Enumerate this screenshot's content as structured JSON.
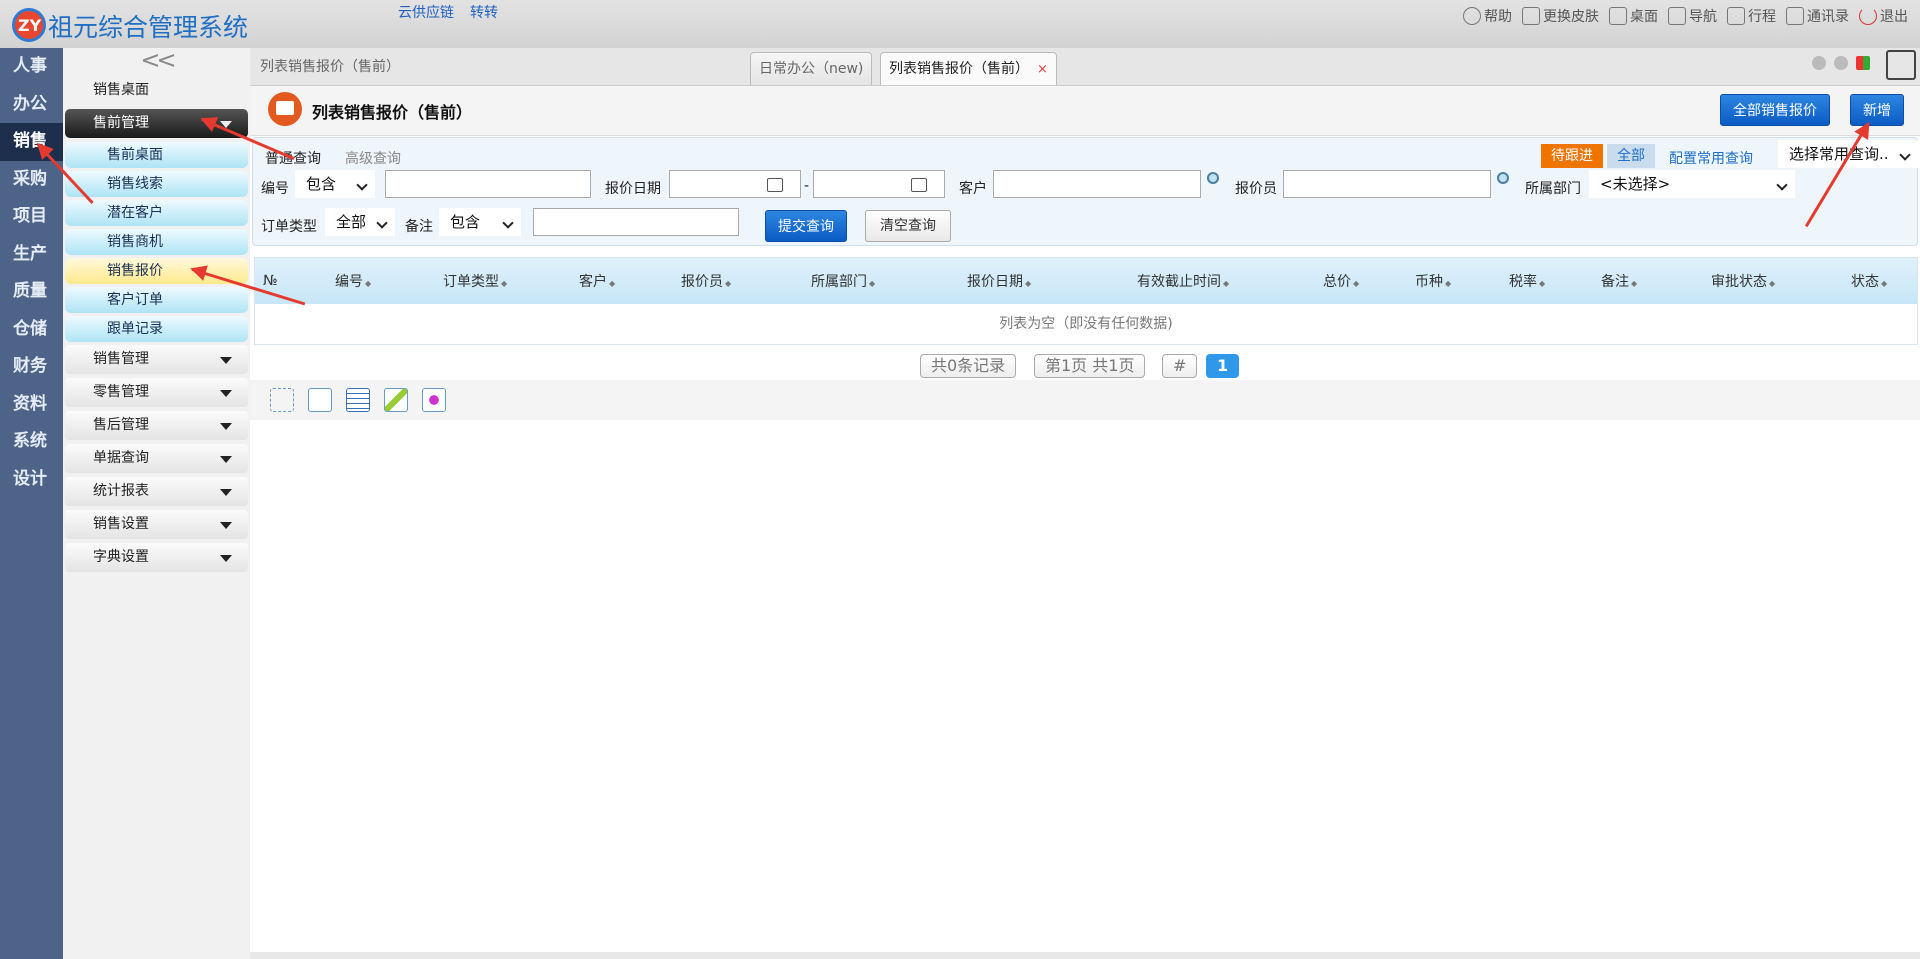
{
  "app": {
    "title": "祖元综合管理系统",
    "logo_text": "ZY",
    "top_links": [
      "云供应链",
      "转转"
    ]
  },
  "top_actions": [
    {
      "label": "帮助",
      "icon": "help-icon"
    },
    {
      "label": "更换皮肤",
      "icon": "shirt-icon"
    },
    {
      "label": "桌面",
      "icon": "home-icon"
    },
    {
      "label": "导航",
      "icon": "grid-icon"
    },
    {
      "label": "行程",
      "icon": "calendar-icon"
    },
    {
      "label": "通讯录",
      "icon": "contacts-icon"
    },
    {
      "label": "退出",
      "icon": "power-icon"
    }
  ],
  "categories": [
    "人事",
    "办公",
    "销售",
    "采购",
    "项目",
    "生产",
    "质量",
    "仓储",
    "财务",
    "资料",
    "系统",
    "设计"
  ],
  "active_category": "销售",
  "submenu": {
    "collapse_glyph": "<<",
    "desk": "销售桌面",
    "presales": "售前管理",
    "presales_children": [
      "售前桌面",
      "销售线索",
      "潜在客户",
      "销售商机",
      "销售报价",
      "客户订单",
      "跟单记录"
    ],
    "active_child": "销售报价",
    "groups": [
      "销售管理",
      "零售管理",
      "售后管理",
      "单据查询",
      "统计报表",
      "销售设置",
      "字典设置"
    ]
  },
  "breadcrumb": "列表销售报价（售前）",
  "tabs": [
    {
      "label": "日常办公（new)"
    },
    {
      "label": "列表销售报价（售前）",
      "close": "×"
    }
  ],
  "page": {
    "title": "列表销售报价（售前）",
    "btn_all": "全部销售报价",
    "btn_new": "新增"
  },
  "query": {
    "tab_normal": "普通查询",
    "tab_advanced": "高级查询",
    "tag_pending": "待跟进",
    "tag_all": "全部",
    "config_link": "配置常用查询",
    "saved_query_placeholder": "选择常用查询..",
    "label_code": "编号",
    "code_op": "包含",
    "label_date": "报价日期",
    "date_sep": "-",
    "label_customer": "客户",
    "label_quoter": "报价员",
    "label_dept": "所属部门",
    "dept_value": "<未选择>",
    "label_order_type": "订单类型",
    "order_type_value": "全部",
    "label_remark": "备注",
    "remark_op": "包含",
    "btn_submit": "提交查询",
    "btn_clear": "清空查询"
  },
  "table": {
    "columns": [
      "№",
      "编号",
      "订单类型",
      "客户",
      "报价员",
      "所属部门",
      "报价日期",
      "有效截止时间",
      "总价",
      "币种",
      "税率",
      "备注",
      "审批状态",
      "状态"
    ],
    "empty_text": "列表为空（即没有任何数据)"
  },
  "pager": {
    "total": "共0条记录",
    "pages": "第1页 共1页",
    "jump": "#",
    "current": "1"
  },
  "colors": {
    "accent_blue": "#1f6fc4",
    "category_bg": "#4d6488",
    "pending_orange": "#f07400",
    "annotation_red": "#e53a2f"
  }
}
